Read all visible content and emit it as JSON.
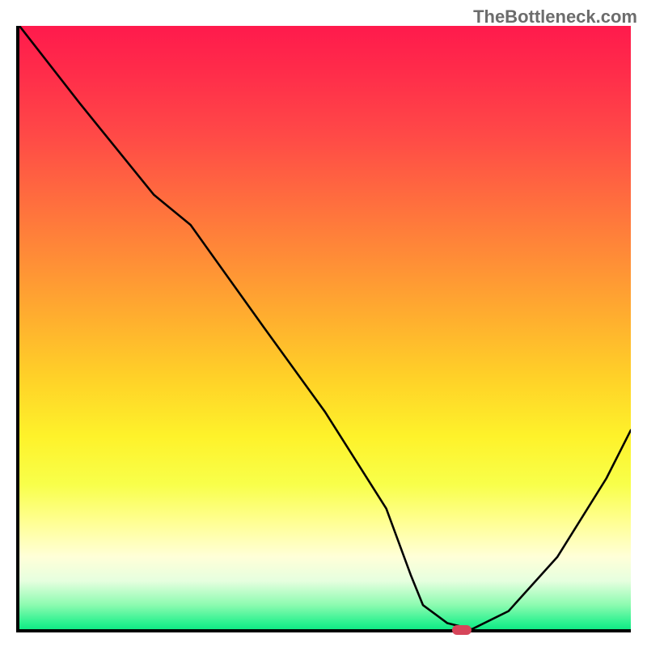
{
  "watermark": "TheBottleneck.com",
  "chart_data": {
    "type": "line",
    "title": "",
    "xlabel": "",
    "ylabel": "",
    "xlim": [
      0,
      100
    ],
    "ylim": [
      0,
      100
    ],
    "grid": false,
    "legend": false,
    "series": [
      {
        "name": "bottleneck-curve",
        "x": [
          0,
          10,
          22,
          28,
          40,
          50,
          60,
          64,
          66,
          70,
          74,
          80,
          88,
          96,
          100
        ],
        "values": [
          100,
          87,
          72,
          67,
          50,
          36,
          20,
          9,
          4,
          1,
          0,
          3,
          12,
          25,
          33
        ]
      }
    ],
    "marker": {
      "x": 72,
      "y": 0
    },
    "background": {
      "gradient_top_color": "#ff1a4c",
      "gradient_mid_color": "#ffd028",
      "gradient_bottom_color": "#11e985"
    }
  }
}
